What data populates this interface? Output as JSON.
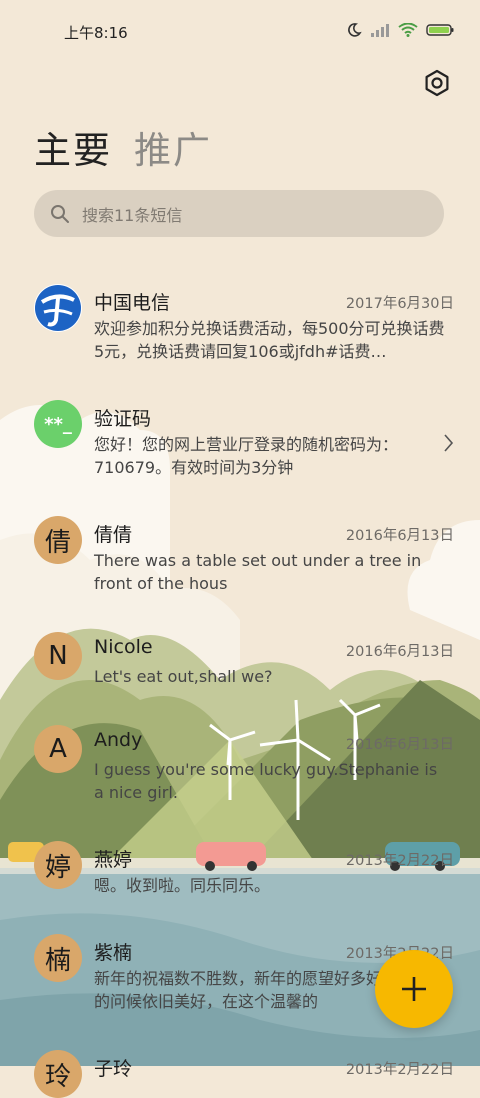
{
  "status_bar": {
    "time": "上午8:16"
  },
  "tabs": {
    "primary": "主要",
    "promo": "推广"
  },
  "search": {
    "placeholder": "搜索11条短信"
  },
  "colors": {
    "fab": "#f7b800",
    "avatar_tan": "#d9a76a",
    "avatar_green": "#6bd06b",
    "telecom_blue": "#1d63c4"
  },
  "messages": [
    {
      "name": "中国电信",
      "date": "2017年6月30日",
      "preview": "欢迎参加积分兑换话费活动，每500分可兑换话费5元，兑换话费请回复106或jfdh#话费…",
      "avatar_icon": "china-telecom-logo-icon"
    },
    {
      "name": "验证码",
      "date": "",
      "preview": "您好！您的网上营业厅登录的随机密码为：710679。有效时间为3分钟",
      "avatar_text": "**_"
    },
    {
      "name": "倩倩",
      "date": "2016年6月13日",
      "preview": "There was a table set out under a tree in front of the hous",
      "avatar_text": "倩"
    },
    {
      "name": "Nicole",
      "date": "2016年6月13日",
      "preview": "Let's eat out,shall we?",
      "avatar_text": "N"
    },
    {
      "name": "Andy",
      "date": "2016年6月13日",
      "preview": "I guess you're some lucky guy.Stephanie is a nice girl.",
      "avatar_text": "A"
    },
    {
      "name": "燕婷",
      "date": "2013年2月22日",
      "preview": "嗯。收到啦。同乐同乐。",
      "avatar_text": "婷"
    },
    {
      "name": "紫楠",
      "date": "2013年2月22日",
      "preview": "新年的祝福数不胜数，新年的愿望好多好多，新年的问候依旧美好，在这个温馨的",
      "avatar_text": "楠"
    },
    {
      "name": "子玲",
      "date": "2013年2月22日",
      "preview": "",
      "avatar_text": "玲"
    }
  ]
}
